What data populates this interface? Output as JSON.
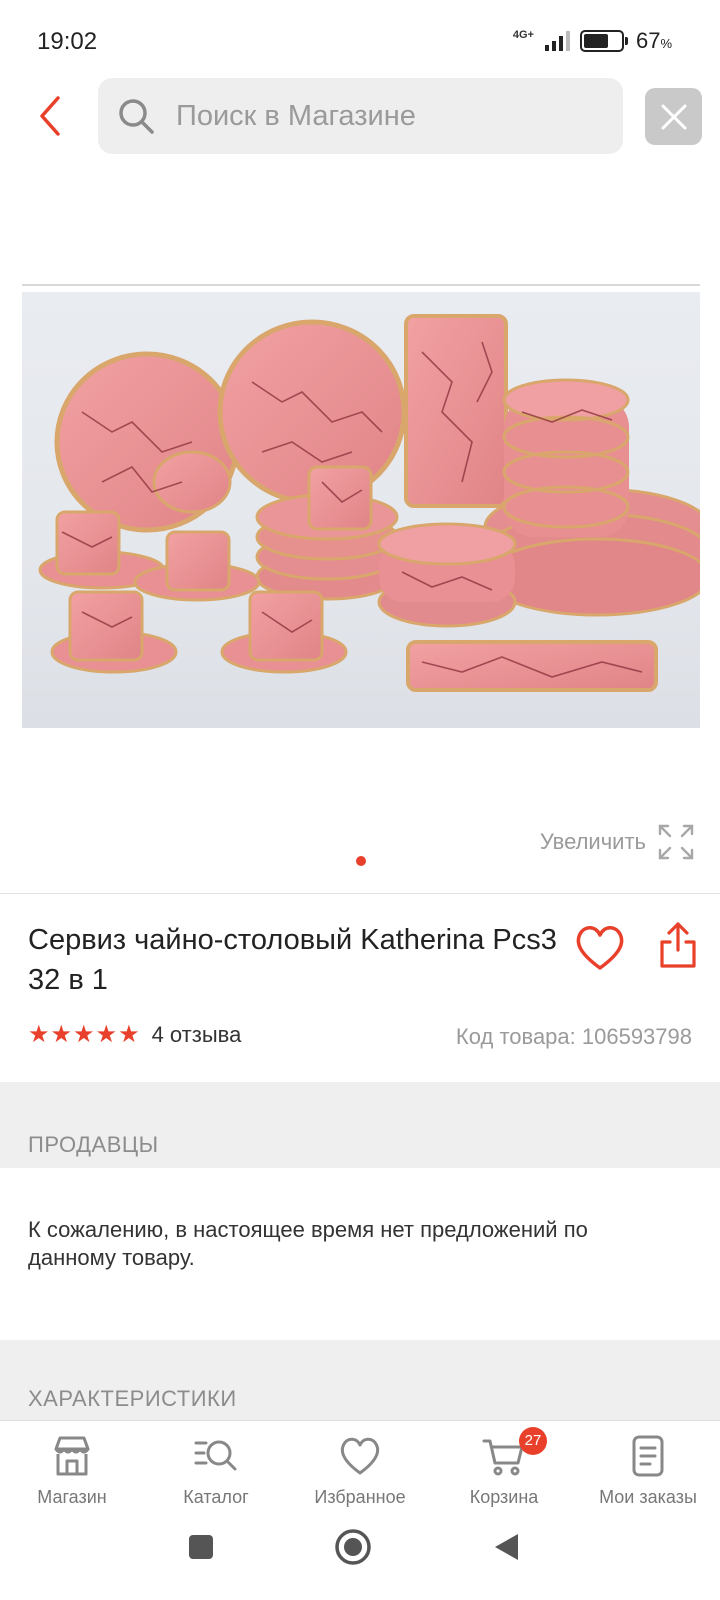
{
  "status": {
    "time": "19:02",
    "network": "4G+",
    "battery_percent": 67,
    "battery_text": "67",
    "battery_unit": "%"
  },
  "search": {
    "placeholder": "Поиск в Магазине",
    "value": ""
  },
  "gallery": {
    "zoom_label": "Увеличить",
    "image_count": 1,
    "active_index": 0
  },
  "product": {
    "title": "Сервиз чайно-столовый Katherina Pcs3 32 в 1",
    "rating": 5,
    "rating_max": 5,
    "reviews_label": "4 отзыва",
    "sku_label": "Код товара: 106593798"
  },
  "sections": {
    "sellers_header": "ПРОДАВЦЫ",
    "no_offers_text": "К сожалению, в настоящее время нет предложений по данному товару.",
    "specs_header": "ХАРАКТЕРИСТИКИ"
  },
  "bottom_nav": {
    "items": [
      {
        "label": "Магазин",
        "icon": "store-icon"
      },
      {
        "label": "Каталог",
        "icon": "catalog-search-icon"
      },
      {
        "label": "Избранное",
        "icon": "heart-icon"
      },
      {
        "label": "Корзина",
        "icon": "cart-icon",
        "badge": "27"
      },
      {
        "label": "Мои заказы",
        "icon": "orders-icon"
      }
    ]
  },
  "colors": {
    "accent": "#e8402a",
    "muted_text": "#9a9a9a",
    "section_band": "#efefef",
    "search_bg": "#eeeeee"
  }
}
